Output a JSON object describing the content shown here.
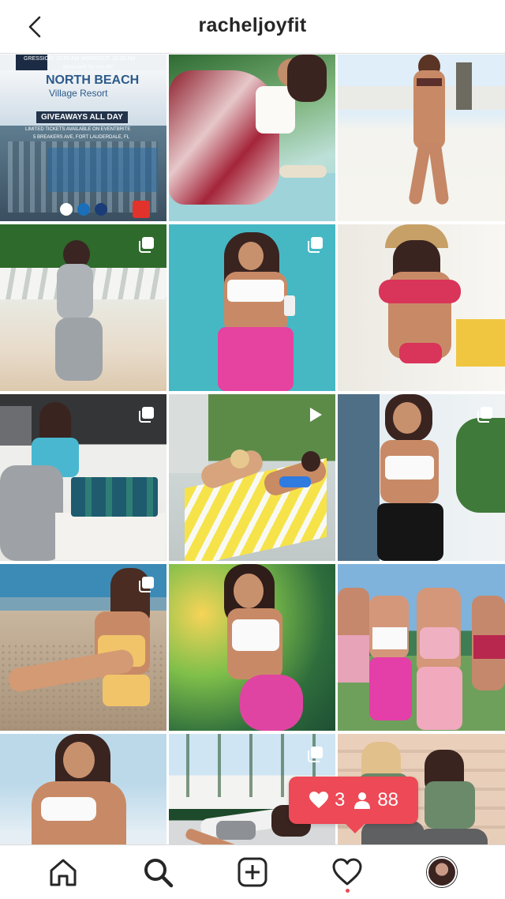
{
  "header": {
    "title": "racheljoyfit",
    "back_icon": "chevron-left-icon"
  },
  "tile_1": {
    "line1": "GRESSION: 10:00 AM    WORKOUT: 10:30 AM",
    "line2": "BROUGHT TO YOU BY",
    "brand": "NORTH BEACH",
    "brand_sub": "Village Resort",
    "giveaway": "GIVEAWAYS ALL DAY",
    "line3": "LIMITED TICKETS AVAILABLE ON EVENTBRITE",
    "line4": "5 BREAKERS AVE, FORT LAUDERDALE, FL"
  },
  "grid": {
    "tiles": [
      {
        "badge": "none"
      },
      {
        "badge": "none"
      },
      {
        "badge": "none"
      },
      {
        "badge": "multiple-icon"
      },
      {
        "badge": "multiple-icon"
      },
      {
        "badge": "none"
      },
      {
        "badge": "multiple-icon"
      },
      {
        "badge": "video-icon"
      },
      {
        "badge": "multiple-icon"
      },
      {
        "badge": "multiple-icon"
      },
      {
        "badge": "none"
      },
      {
        "badge": "none"
      },
      {
        "badge": "none"
      },
      {
        "badge": "multiple-icon"
      },
      {
        "badge": "none"
      }
    ]
  },
  "notification": {
    "likes": "3",
    "followers": "88",
    "color": "#ed4956"
  },
  "bottom_nav": {
    "items": [
      "home-icon",
      "search-icon",
      "new-post-icon",
      "activity-heart-icon",
      "profile-avatar"
    ]
  }
}
